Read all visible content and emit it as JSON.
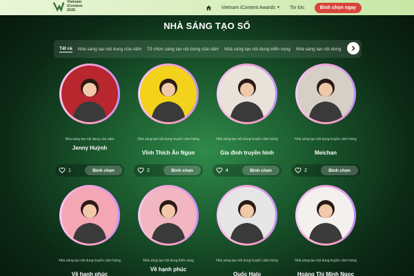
{
  "header": {
    "logo_lines": [
      "Vietnam",
      "iContent",
      "2025"
    ],
    "nav": {
      "home_icon": "home-icon",
      "awards": "Vietnam iContent Awards",
      "news": "Tin tức",
      "vote_now": "Bình chọn ngay"
    }
  },
  "page_title": "NHÀ SÁNG TẠO SỐ",
  "tabs": [
    "Tất cả",
    "Nhà sáng tạo nội dung của năm",
    "Tổ chức sáng tạo nội dung của năm",
    "Nhà sáng tạo nội dung triển vọng",
    "Nhà sáng tạo nội dung"
  ],
  "cards": [
    {
      "category": "Nhà sáng tạo nội dung của năm",
      "name": "Jenny Huỳnh",
      "votes": "1",
      "vote_label": "Bình chọn",
      "bg": "#b8262e"
    },
    {
      "category": "Nhà sáng tạo nội dung truyền cảm hứng",
      "name": "Vĩnh Thích Ăn Ngon",
      "votes": "2",
      "vote_label": "Bình chọn",
      "bg": "#f2d21a"
    },
    {
      "category": "Nhà sáng tạo nội dung truyền cảm hứng",
      "name": "Gia đình truyền hình",
      "votes": "4",
      "vote_label": "Bình chọn",
      "bg": "#e9e2da"
    },
    {
      "category": "Nhà sáng tạo nội dung truyền cảm hứng",
      "name": "Meichan",
      "votes": "2",
      "vote_label": "Bình chọn",
      "bg": "#d6cfc6"
    },
    {
      "category": "Nhà sáng tạo nội dung truyền cảm hứng",
      "name": "Về hạnh phúc",
      "bg": "#f4a6b5"
    },
    {
      "category": "Nhà sáng tạo nội dung triển vọng",
      "name": "Về hạnh phúc",
      "bg": "#f2b6c2"
    },
    {
      "category": "Nhà sáng tạo nội dung truyền cảm hứng",
      "name": "Quốc Halo",
      "bg": "#e6e6e6"
    },
    {
      "category": "Nhà sáng tạo nội dung truyền cảm hứng",
      "name": "Hoàng Thị Minh Ngọc",
      "bg": "#f4f0ee"
    }
  ]
}
